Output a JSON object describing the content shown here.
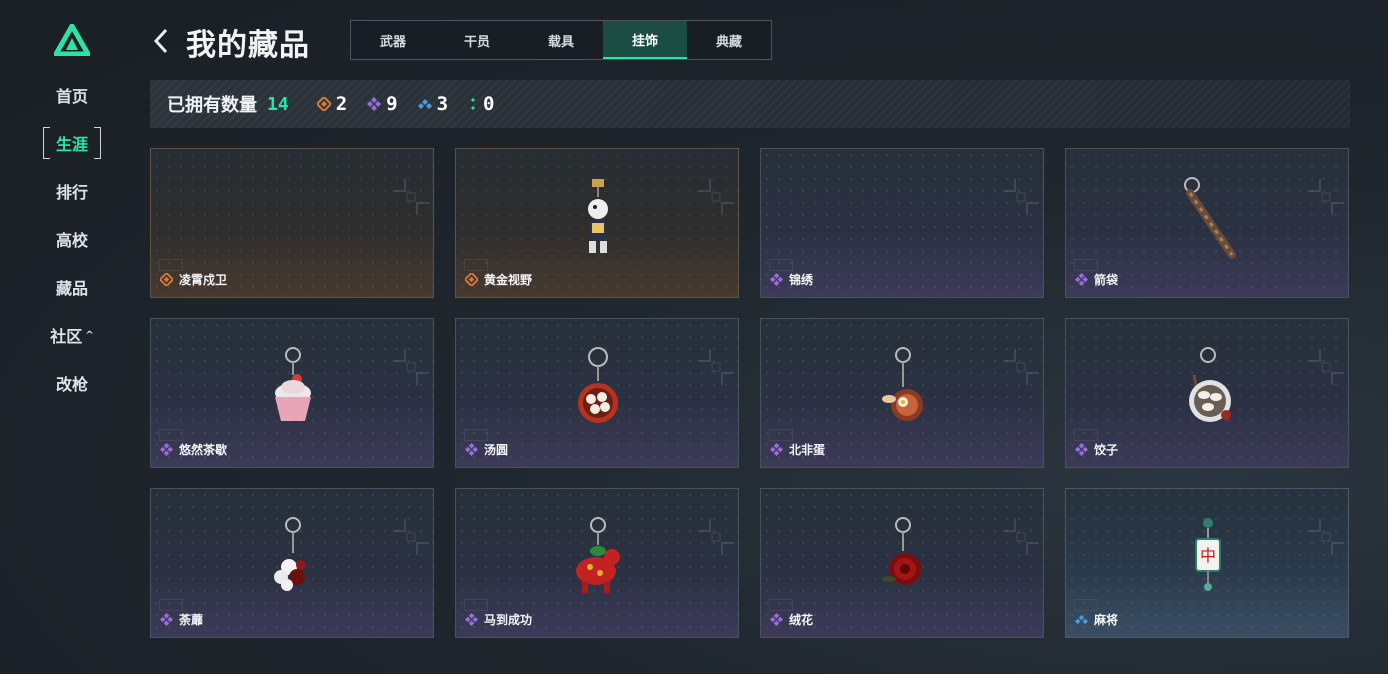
{
  "sidebar": {
    "items": [
      {
        "label": "首页"
      },
      {
        "label": "生涯",
        "active": true
      },
      {
        "label": "排行"
      },
      {
        "label": "高校"
      },
      {
        "label": "藏品"
      },
      {
        "label": "社区",
        "caret": "^"
      },
      {
        "label": "改枪"
      }
    ]
  },
  "header": {
    "title": "我的藏品",
    "tabs": [
      {
        "label": "武器"
      },
      {
        "label": "干员"
      },
      {
        "label": "载具"
      },
      {
        "label": "挂饰",
        "active": true
      },
      {
        "label": "典藏"
      }
    ]
  },
  "summary": {
    "label": "已拥有数量",
    "total": "14",
    "rarities": [
      {
        "icon": "gold-diamond-icon",
        "color": "#d9793a",
        "count": "2"
      },
      {
        "icon": "purple-diamond-icon",
        "color": "#9b6be0",
        "count": "9"
      },
      {
        "icon": "blue-diamond-icon",
        "color": "#4b9be0",
        "count": "3"
      },
      {
        "icon": "green-dots-icon",
        "color": "#2de3a4",
        "count": "0"
      }
    ]
  },
  "items": [
    {
      "name": "凌霄戍卫",
      "rarity": "gold",
      "icon": "empty"
    },
    {
      "name": "黄金视野",
      "rarity": "gold",
      "icon": "figure-charm-icon"
    },
    {
      "name": "锦绣",
      "rarity": "purple",
      "icon": "empty"
    },
    {
      "name": "箭袋",
      "rarity": "purple",
      "icon": "quiver-charm-icon"
    },
    {
      "name": "悠然茶歇",
      "rarity": "purple",
      "icon": "cupcake-charm-icon"
    },
    {
      "name": "汤圆",
      "rarity": "purple",
      "icon": "tangyuan-charm-icon"
    },
    {
      "name": "北非蛋",
      "rarity": "purple",
      "icon": "shakshuka-charm-icon"
    },
    {
      "name": "饺子",
      "rarity": "purple",
      "icon": "dumpling-charm-icon"
    },
    {
      "name": "荼蘼",
      "rarity": "purple",
      "icon": "flower-white-charm-icon"
    },
    {
      "name": "马到成功",
      "rarity": "purple",
      "icon": "horse-charm-icon"
    },
    {
      "name": "绒花",
      "rarity": "purple",
      "icon": "rose-charm-icon"
    },
    {
      "name": "麻将",
      "rarity": "blue",
      "icon": "mahjong-charm-icon"
    }
  ],
  "colors": {
    "accent": "#2de3a4",
    "gold": "#d9793a",
    "purple": "#9b6be0",
    "blue": "#4b9be0"
  }
}
